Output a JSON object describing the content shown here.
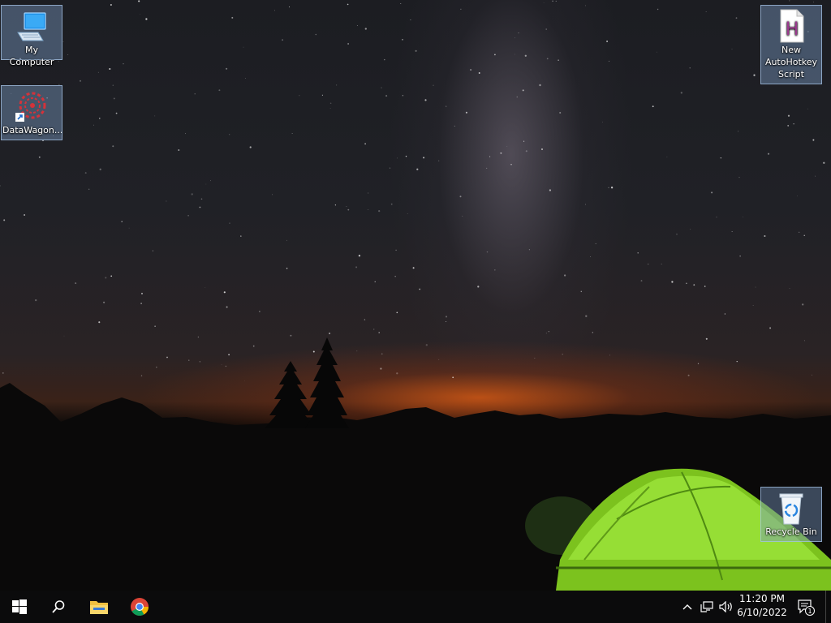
{
  "desktop": {
    "wallpaper": "night sky milky way with green tent",
    "icons": [
      {
        "id": "my-computer",
        "label": "My Computer",
        "icon": "computer-icon"
      },
      {
        "id": "datawagon",
        "label": "DataWagon...",
        "icon": "datawagon-icon"
      },
      {
        "id": "autohotkey",
        "label": "New AutoHotkey Script",
        "icon": "autohotkey-script-icon"
      },
      {
        "id": "recycle-bin",
        "label": "Recycle Bin",
        "icon": "recycle-bin-icon"
      }
    ]
  },
  "taskbar": {
    "start": "windows-start-icon",
    "search": "search-icon",
    "pinned": [
      "file-explorer-icon",
      "chrome-icon"
    ],
    "tray": {
      "icons": [
        "chevron-up-icon",
        "network-icon",
        "volume-icon"
      ],
      "time": "11:20 PM",
      "date": "6/10/2022",
      "notification_count": "1"
    }
  },
  "colors": {
    "taskbar": "#0b0b0c",
    "icon_selection": "#7896be",
    "tent": "#8fd62a"
  }
}
